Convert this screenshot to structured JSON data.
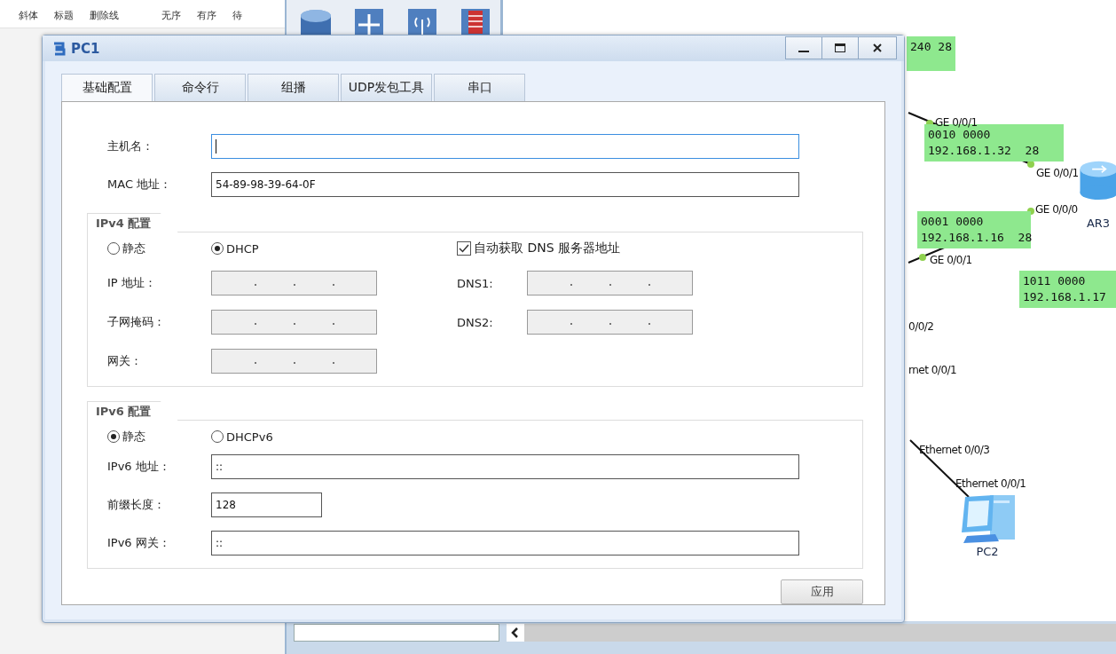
{
  "editor_toolbar": {
    "buttons": [
      "斜体",
      "标题",
      "删除线",
      "无序",
      "有序",
      "待"
    ]
  },
  "topology": {
    "subnet_notes": [
      {
        "lines": [
          "240 28"
        ]
      },
      {
        "lines": [
          "0010 0000",
          "192.168.1.32  28"
        ]
      },
      {
        "lines": [
          "0001 0000",
          "192.168.1.16  28"
        ]
      },
      {
        "lines": [
          "1011 0000",
          "192.168.1.17"
        ]
      }
    ],
    "port_labels": [
      "GE 0/0/1",
      "GE 0/0/1",
      "GE 0/0/0",
      "GE 0/0/1",
      "0/0/2",
      "rnet 0/0/1",
      "Ethernet 0/0/3",
      "Ethernet 0/0/1"
    ],
    "devices": [
      {
        "kind": "router",
        "name": "AR3"
      },
      {
        "kind": "pc",
        "name": "PC2"
      }
    ]
  },
  "dialog": {
    "title": "PC1",
    "tabs": [
      {
        "label": "基础配置",
        "selected": true
      },
      {
        "label": "命令行",
        "selected": false
      },
      {
        "label": "组播",
        "selected": false
      },
      {
        "label": "UDP发包工具",
        "selected": false
      },
      {
        "label": "串口",
        "selected": false
      }
    ],
    "host_name": {
      "label": "主机名：",
      "focused": true
    },
    "mac": {
      "label": "MAC 地址：",
      "value": "54-89-98-39-64-0F"
    },
    "ipv4": {
      "title": "IPv4 配置",
      "modes": [
        {
          "label": "静态",
          "selected": false
        },
        {
          "label": "DHCP",
          "selected": true
        }
      ],
      "auto_dns": {
        "label": "自动获取 DNS 服务器地址",
        "checked": true
      },
      "fields": [
        {
          "label": "IP 地址：",
          "disabled": true
        },
        {
          "label": "子网掩码：",
          "disabled": true
        },
        {
          "label": "网关：",
          "disabled": true
        }
      ],
      "dns_fields": [
        {
          "label": "DNS1:",
          "disabled": true
        },
        {
          "label": "DNS2:",
          "disabled": true
        }
      ]
    },
    "ipv6": {
      "title": "IPv6 配置",
      "modes": [
        {
          "label": "静态",
          "selected": true
        },
        {
          "label": "DHCPv6",
          "selected": false
        }
      ],
      "fields": [
        {
          "label": "IPv6 地址：",
          "value": "::",
          "kind": "wide"
        },
        {
          "label": "前缀长度：",
          "value": "128",
          "kind": "short"
        },
        {
          "label": "IPv6 网关：",
          "value": "::",
          "kind": "wide"
        }
      ]
    },
    "apply_button": "应用"
  }
}
